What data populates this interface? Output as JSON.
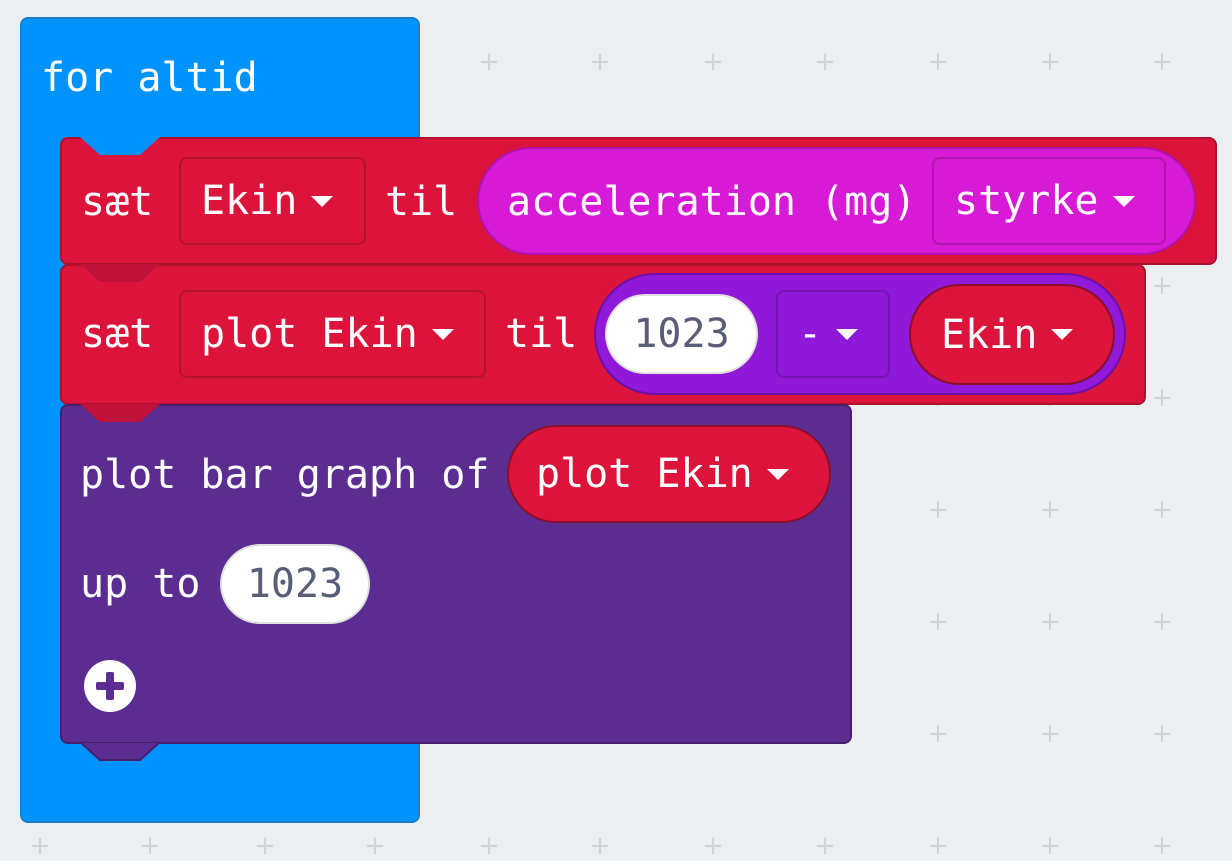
{
  "forever_block": {
    "label": "for altid"
  },
  "set_block_1": {
    "set_word": "sæt",
    "variable": "Ekin",
    "to_word": "til",
    "sensor_label": "acceleration (mg)",
    "sensor_dimension": "styrke"
  },
  "set_block_2": {
    "set_word": "sæt",
    "variable": "plot Ekin",
    "to_word": "til",
    "left_operand": "1023",
    "operator": "-",
    "right_operand_variable": "Ekin"
  },
  "plot_block": {
    "label": "plot bar graph of",
    "variable": "plot Ekin",
    "up_to_label": "up to",
    "up_to_value": "1023",
    "expand_icon": "plus-circle-icon"
  },
  "colors": {
    "loops": "#0093fb",
    "variables": "#dc143c",
    "input": "#d71ad5",
    "math": "#9018d8",
    "led": "#5c2d91",
    "workspace": "#eceff1"
  }
}
